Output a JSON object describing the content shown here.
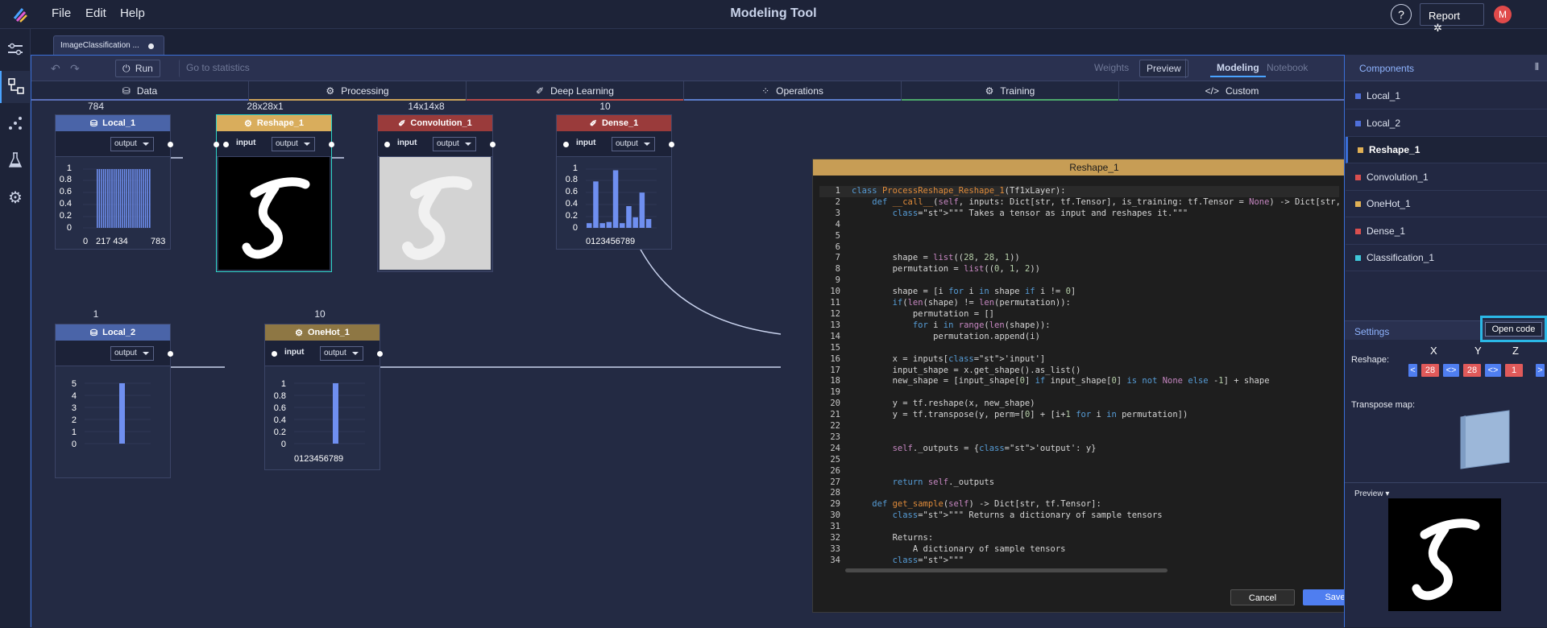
{
  "menu": {
    "file": "File",
    "edit": "Edit",
    "help": "Help"
  },
  "app_title": "Modeling Tool",
  "header_right": {
    "help": "?",
    "report": "Report",
    "avatar": "M"
  },
  "doc_tab": {
    "name": "ImageClassification ..."
  },
  "toolbar": {
    "run": "Run",
    "go_stats": "Go to statistics",
    "weights": "Weights",
    "preview": "Preview",
    "modeling": "Modeling",
    "notebook": "Notebook"
  },
  "categories": [
    {
      "label": "Data",
      "color": "#5b6fb8"
    },
    {
      "label": "Processing",
      "color": "#c9a15a"
    },
    {
      "label": "Deep Learning",
      "color": "#b84a4a"
    },
    {
      "label": "Operations",
      "color": "#5b7cc9"
    },
    {
      "label": "Training",
      "color": "#4ca86b"
    },
    {
      "label": "Custom",
      "color": "#5b6fb8"
    }
  ],
  "nodes": {
    "local1": {
      "title": "Local_1",
      "shape": "784",
      "out": "output",
      "yticks": [
        "1",
        "0.8",
        "0.6",
        "0.4",
        "0.2",
        "0"
      ],
      "xticks": "0   217 434    783"
    },
    "reshape1": {
      "title": "Reshape_1",
      "shape": "28x28x1",
      "in": "input",
      "out": "output"
    },
    "conv1": {
      "title": "Convolution_1",
      "shape": "14x14x8",
      "in": "input",
      "out": "output"
    },
    "dense1": {
      "title": "Dense_1",
      "shape": "10",
      "in": "input",
      "out": "output",
      "yticks": [
        "1",
        "0.8",
        "0.6",
        "0.4",
        "0.2",
        "0"
      ],
      "xticks": "0123456789",
      "values": [
        0.08,
        0.79,
        0.08,
        0.1,
        0.98,
        0.08,
        0.37,
        0.18,
        0.6,
        0.15
      ]
    },
    "local2": {
      "title": "Local_2",
      "shape": "1",
      "out": "output",
      "yticks": [
        "5",
        "4",
        "3",
        "2",
        "1",
        "0"
      ]
    },
    "onehot1": {
      "title": "OneHot_1",
      "shape": "10",
      "in": "input",
      "out": "output",
      "yticks": [
        "1",
        "0.8",
        "0.6",
        "0.4",
        "0.2",
        "0"
      ],
      "xticks": "0123456789"
    }
  },
  "modal": {
    "title": "Reshape_1",
    "close": "×",
    "cancel": "Cancel",
    "save": "Save",
    "code": [
      "class ProcessReshape_Reshape_1(Tf1xLayer):",
      "    def __call__(self, inputs: Dict[str, tf.Tensor], is_training: tf.Tensor = None) -> Dict[str, t",
      "        \"\"\" Takes a tensor as input and reshapes it.\"\"\"",
      "",
      "",
      "",
      "        shape = list((28, 28, 1))",
      "        permutation = list((0, 1, 2))",
      "",
      "        shape = [i for i in shape if i != 0]",
      "        if(len(shape) != len(permutation)):",
      "            permutation = []",
      "            for i in range(len(shape)):",
      "                permutation.append(i)",
      "",
      "        x = inputs['input']",
      "        input_shape = x.get_shape().as_list()",
      "        new_shape = [input_shape[0] if input_shape[0] is not None else -1] + shape",
      "",
      "        y = tf.reshape(x, new_shape)",
      "        y = tf.transpose(y, perm=[0] + [i+1 for i in permutation])",
      "",
      "",
      "        self._outputs = {'output': y}",
      "",
      "",
      "        return self._outputs",
      "",
      "    def get_sample(self) -> Dict[str, tf.Tensor]:",
      "        \"\"\" Returns a dictionary of sample tensors",
      "",
      "        Returns:",
      "            A dictionary of sample tensors",
      "        \"\"\""
    ]
  },
  "components": {
    "title": "Components",
    "items": [
      {
        "label": "Local_1",
        "color": "#4f6fd9"
      },
      {
        "label": "Local_2",
        "color": "#4f6fd9"
      },
      {
        "label": "Reshape_1",
        "color": "#e0b055"
      },
      {
        "label": "Convolution_1",
        "color": "#d94f4f"
      },
      {
        "label": "OneHot_1",
        "color": "#e0b055"
      },
      {
        "label": "Dense_1",
        "color": "#d94f4f"
      },
      {
        "label": "Classification_1",
        "color": "#3fc7d9"
      }
    ]
  },
  "settings": {
    "title": "Settings",
    "open_code": "Open code",
    "reshape_label": "Reshape:",
    "axes": [
      "X",
      "Y",
      "Z"
    ],
    "values": [
      "28",
      "28",
      "1"
    ],
    "left": "<",
    "swap": "<>",
    "right": ">",
    "transpose_label": "Transpose map:",
    "preview_label": "Preview"
  }
}
